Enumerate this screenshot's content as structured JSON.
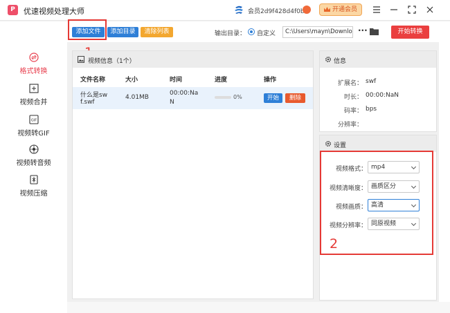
{
  "app": {
    "title": "优速视频处理大师",
    "logo_text": "P",
    "member_id": "会员2d9f428d4f0b",
    "open_vip": "开通会员"
  },
  "sidebar": {
    "items": [
      {
        "label": "格式转换",
        "icon": "format-convert-icon",
        "active": true
      },
      {
        "label": "视频合并",
        "icon": "merge-icon",
        "active": false
      },
      {
        "label": "视频转GIF",
        "icon": "gif-icon",
        "active": false
      },
      {
        "label": "视频转音频",
        "icon": "audio-icon",
        "active": false
      },
      {
        "label": "视频压缩",
        "icon": "compress-icon",
        "active": false
      }
    ]
  },
  "toolbar": {
    "add_file": "添加文件",
    "add_dir": "添加目录",
    "clear_list": "清除列表",
    "output_label": "输出目录：",
    "custom_option": "自定义",
    "output_path": "C:\\Users\\mayn\\Downlo",
    "more": "···",
    "start_convert": "开始转换"
  },
  "annotations": {
    "one": "1",
    "two": "2"
  },
  "video_panel": {
    "header": "视频信息（1个）",
    "columns": [
      "文件名称",
      "大小",
      "时间",
      "进度",
      "操作"
    ],
    "rows": [
      {
        "name_line1": "什么是sw",
        "name_line2": "f.swf",
        "size": "4.01MB",
        "time_line1": "00:00:Na",
        "time_line2": "N",
        "progress": "0%",
        "start": "开始",
        "delete": "删除"
      }
    ]
  },
  "info_panel": {
    "title": "信息",
    "fields": [
      {
        "key": "扩展名：",
        "value": "swf"
      },
      {
        "key": "时长：",
        "value": "00:00:NaN"
      },
      {
        "key": "码率：",
        "value": "bps"
      },
      {
        "key": "分辨率：",
        "value": ""
      }
    ]
  },
  "settings_panel": {
    "title": "设置",
    "fields": [
      {
        "label": "视频格式：",
        "value": "mp4"
      },
      {
        "label": "视频清晰度：",
        "value": "画质区分"
      },
      {
        "label": "视频画质：",
        "value": "高清"
      },
      {
        "label": "视频分辨率：",
        "value": "同原视频"
      }
    ]
  },
  "colors": {
    "accent_blue": "#2e7fd7",
    "accent_red": "#ea3f3f",
    "clear_orange": "#f3a72f",
    "annotation_red": "#e53935"
  }
}
